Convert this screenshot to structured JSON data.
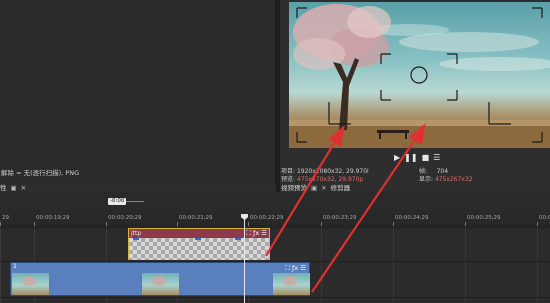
{
  "left_panel": {
    "properties_line": "解除 = 无(逐行扫描), PNG"
  },
  "bottom_tabs_left": {
    "label": "性",
    "float_glyph": "▣",
    "close_glyph": "✕"
  },
  "preview": {
    "transport": {
      "play_glyph": "▶",
      "pause_glyph": "❚❚",
      "stop_glyph": "■",
      "menu_glyph": "☰"
    },
    "info": {
      "project_label": "项目:",
      "project_value": "1920x1080x32, 29.970i",
      "preview_label": "预览:",
      "preview_value": "475x270x32, 29.970p",
      "frame_label": "帧:",
      "frame_value": "704",
      "display_label": "显示:",
      "display_value": "475x267x32"
    },
    "tabs": {
      "video_preview": "视频预览",
      "float_glyph": "▣",
      "close_glyph": "✕",
      "trimmer": "修剪器"
    }
  },
  "timeline": {
    "time_badge": "-0:00",
    "ruler_labels": [
      "29",
      "00:00:19;29",
      "00:00:20;29",
      "00:00:21;29",
      "00:00:22;29",
      "00:00:23;29",
      "00:00:24;29",
      "00:00:25;29",
      "00:00:26;29",
      "00:00:27;29"
    ],
    "upper_clip": {
      "name": "jttp",
      "crop_glyph": "⛶",
      "fx_glyph": "ƒx",
      "menu_glyph": "☰"
    },
    "lower_clip": {
      "number": "1",
      "crop_glyph": "⛶",
      "fx_glyph": "ƒx",
      "menu_glyph": "☰"
    }
  },
  "colors": {
    "annotation_arrow": "#e03030",
    "upper_clip_header": "#8c3a4a",
    "upper_clip_border": "#d4b640",
    "lower_clip_body": "#5a7fbf"
  }
}
